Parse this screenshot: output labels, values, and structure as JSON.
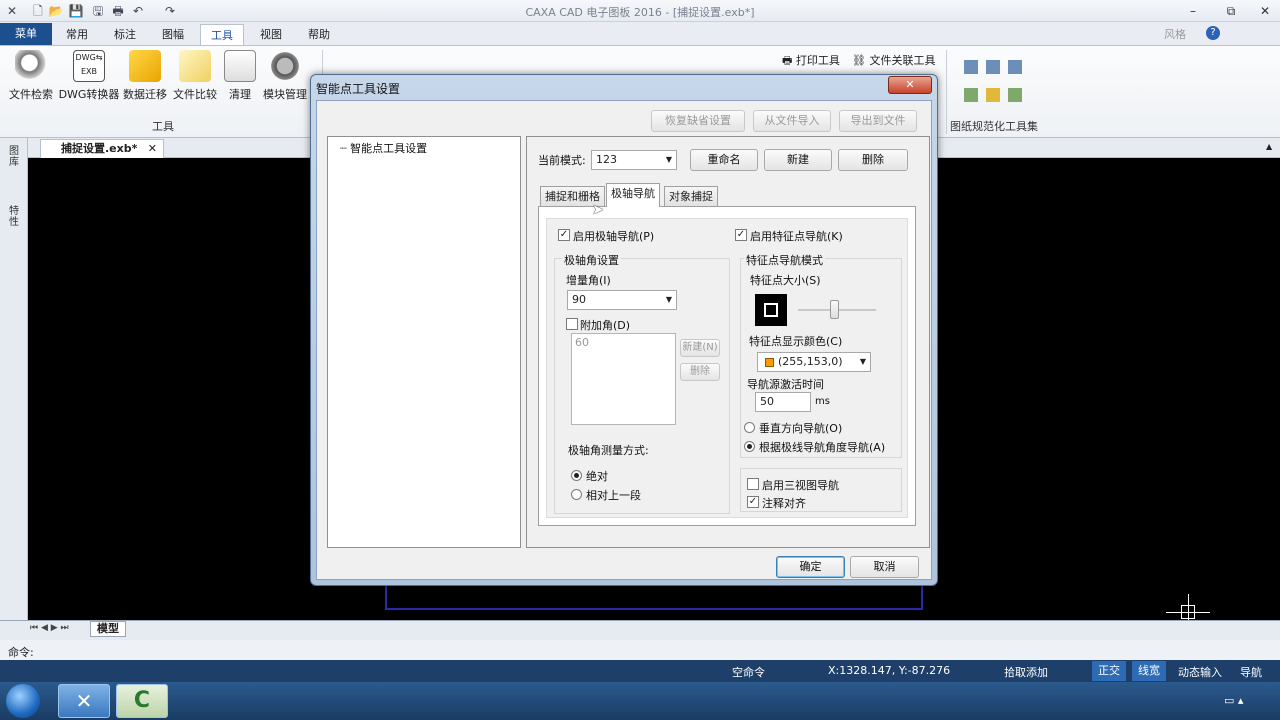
{
  "window": {
    "title": "CAXA CAD 电子图板 2016 - [捕捉设置.exb*]",
    "right_label": "风格"
  },
  "ribbon_tabs": [
    "菜单",
    "常用",
    "标注",
    "图幅",
    "工具",
    "视图",
    "帮助"
  ],
  "ribbon": {
    "buttons": [
      "文件检索",
      "DWG转换器",
      "数据迁移",
      "文件比较",
      "清理",
      "模块管理"
    ],
    "group_label": "工具",
    "print_tool": "打印工具",
    "file_link_tool": "文件关联工具",
    "standard_group": "图纸规范化工具集"
  },
  "doc_tab": "捕捉设置.exb*",
  "left_panel": [
    "图库",
    "特性"
  ],
  "model_tab": "模型",
  "command_label": "命令:",
  "status": {
    "command": "空命令",
    "coords": "X:1328.147, Y:-87.276",
    "pick": "拾取添加",
    "ortho": "正交",
    "linewidth": "线宽",
    "dyn_input": "动态输入",
    "nav": "导航"
  },
  "dialog": {
    "title": "智能点工具设置",
    "close": "✕",
    "restore_default": "恢复缺省设置",
    "import_file": "从文件导入",
    "export_file": "导出到文件",
    "tree_item": "智能点工具设置",
    "current_mode_label": "当前模式:",
    "current_mode_value": "123",
    "rename": "重命名",
    "new": "新建",
    "delete": "删除",
    "tabs": [
      "捕捉和栅格",
      "极轴导航",
      "对象捕捉"
    ],
    "ok": "确定",
    "cancel": "取消",
    "polar": {
      "enable": "启用极轴导航(P)",
      "angle_settings": "极轴角设置",
      "increment_label": "增量角(I)",
      "increment_value": "90",
      "additional": "附加角(D)",
      "additional_value": "60",
      "add_new": "新建(N)",
      "remove": "删除",
      "measure_label": "极轴角测量方式:",
      "absolute": "绝对",
      "relative": "相对上一段"
    },
    "feature": {
      "enable": "启用特征点导航(K)",
      "mode_title": "特征点导航模式",
      "size_label": "特征点大小(S)",
      "color_label": "特征点显示颜色(C)",
      "color_value": "(255,153,0)",
      "color_hex": "#ff9900",
      "activate_label": "导航源激活时间",
      "activate_value": "50",
      "activate_unit": "ms",
      "vertical": "垂直方向导航(O)",
      "by_polar": "根据极线导航角度导航(A)",
      "three_view": "启用三视图导航",
      "annotation_align": "注释对齐"
    }
  }
}
